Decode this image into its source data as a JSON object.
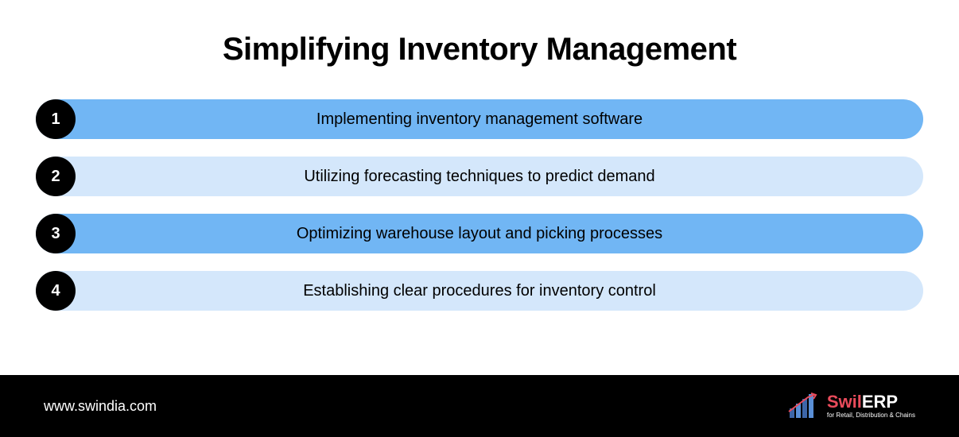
{
  "title": "Simplifying Inventory Management",
  "rows": [
    {
      "n": "1",
      "text": "Implementing inventory management software"
    },
    {
      "n": "2",
      "text": "Utilizing forecasting techniques to predict demand"
    },
    {
      "n": "3",
      "text": "Optimizing warehouse layout and picking processes"
    },
    {
      "n": "4",
      "text": "Establishing clear procedures for inventory control"
    }
  ],
  "footer": {
    "url": "www.swindia.com",
    "brand_a": "Swil",
    "brand_b": "ERP",
    "tagline": "for Retail, Distribution & Chains"
  }
}
